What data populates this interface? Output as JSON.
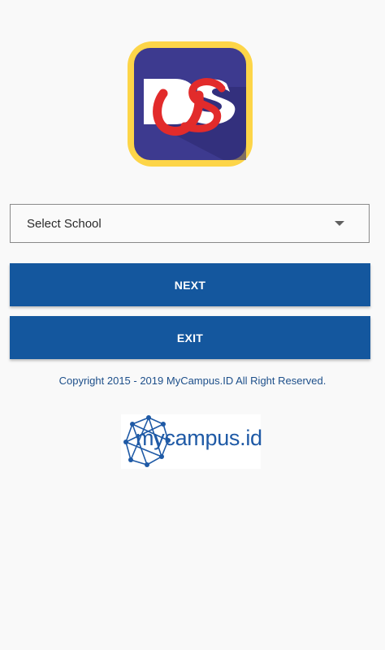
{
  "app_icon": {
    "icon": "ds-app-logo-icon",
    "letters": "DS",
    "colors": {
      "frame": "#fdd548",
      "background": "#3d3a8f",
      "accent": "#e22b2b"
    }
  },
  "school_select": {
    "selected": "Select School",
    "icon": "dropdown-arrow-icon"
  },
  "buttons": {
    "next": "NEXT",
    "exit": "EXIT",
    "color": "#14579e"
  },
  "footer": {
    "copyright": "Copyright 2015 - 2019 MyCampus.ID All Right Reserved."
  },
  "brand": {
    "name": "mycampus.id",
    "icon": "network-globe-icon",
    "color": "#1f5aa6"
  }
}
